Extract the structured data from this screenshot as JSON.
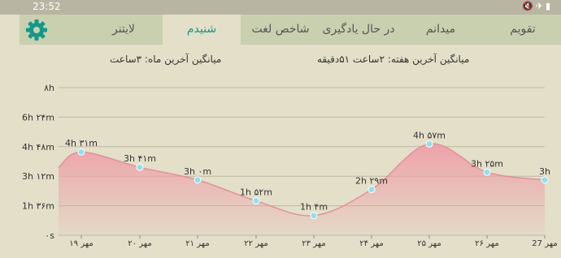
{
  "status_bar": {
    "time": "23:52",
    "icons": [
      "mute-icon",
      "airplane-icon",
      "battery-icon"
    ]
  },
  "tabs": [
    {
      "label": "تقویم",
      "active": false
    },
    {
      "label": "میدانم",
      "active": false
    },
    {
      "label": "در حال یادگیری",
      "active": false
    },
    {
      "label": "شاخص لغت",
      "active": false
    },
    {
      "label": "شنیدم",
      "active": true
    },
    {
      "label": "لایتنر",
      "active": false
    }
  ],
  "settings_icon": "gear-icon",
  "averages": {
    "week": "میانگین آخرین هفته: ۲ساعت ۵۱دقیقه",
    "month": "میانگین آخرین ماه: ۳ساعت"
  },
  "colors": {
    "accent": "#14988a",
    "area": "#ee9fa8",
    "line": "#e48f99",
    "point": "#8fe0f0"
  },
  "chart_data": {
    "type": "area",
    "y_unit": "minutes",
    "ylim": [
      0,
      400
    ],
    "yticks": [
      {
        "value": 0,
        "label": "۰s"
      },
      {
        "value": 96,
        "label": "1h ۳۶m"
      },
      {
        "value": 192,
        "label": "3h ۱۲m"
      },
      {
        "value": 288,
        "label": "4h ۴۸m"
      },
      {
        "value": 384,
        "label": "6h ۲۴m"
      },
      {
        "value": 480,
        "label": "۸h"
      }
    ],
    "categories": [
      "۱۹ مهر",
      "۲۰ مهر",
      "۲۱ مهر",
      "۲۲ مهر",
      "۲۳ مهر",
      "۲۴ مهر",
      "۲۵ مهر",
      "۲۶ مهر",
      "27 مهر"
    ],
    "values": [
      271,
      221,
      180,
      112,
      64,
      149,
      297,
      205,
      180
    ],
    "value_labels": [
      "4h ۳۱m",
      "3h ۴۱m",
      "3h ۰m",
      "1h ۵۲m",
      "1h ۴m",
      "2h ۲۹m",
      "4h ۵۷m",
      "3h ۲۵m",
      "3h"
    ],
    "grid": true
  }
}
